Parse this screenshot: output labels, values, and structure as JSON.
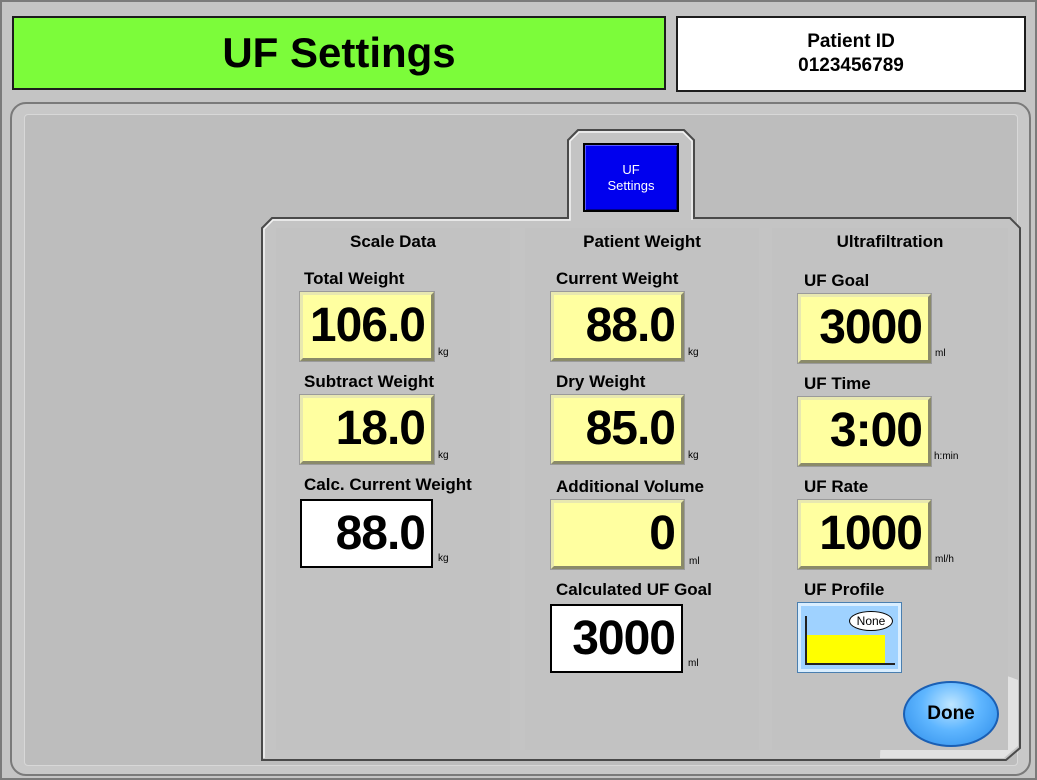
{
  "header": {
    "title": "UF Settings",
    "patient_id_label": "Patient ID",
    "patient_id_value": "0123456789"
  },
  "tab": {
    "line1": "UF",
    "line2": "Settings"
  },
  "scale_data": {
    "title": "Scale Data",
    "total_weight_label": "Total Weight",
    "total_weight_value": "106.0",
    "total_weight_unit": "kg",
    "subtract_weight_label": "Subtract Weight",
    "subtract_weight_value": "18.0",
    "subtract_weight_unit": "kg",
    "calc_current_weight_label": "Calc. Current Weight",
    "calc_current_weight_value": "88.0",
    "calc_current_weight_unit": "kg"
  },
  "patient_weight": {
    "title": "Patient Weight",
    "current_weight_label": "Current Weight",
    "current_weight_value": "88.0",
    "current_weight_unit": "kg",
    "dry_weight_label": "Dry Weight",
    "dry_weight_value": "85.0",
    "dry_weight_unit": "kg",
    "additional_volume_label": "Additional Volume",
    "additional_volume_value": "0",
    "additional_volume_unit": "ml",
    "calculated_uf_goal_label": "Calculated UF Goal",
    "calculated_uf_goal_value": "3000",
    "calculated_uf_goal_unit": "ml"
  },
  "ultrafiltration": {
    "title": "Ultrafiltration",
    "uf_goal_label": "UF Goal",
    "uf_goal_value": "3000",
    "uf_goal_unit": "ml",
    "uf_time_label": "UF Time",
    "uf_time_value": "3:00",
    "uf_time_unit": "h:min",
    "uf_rate_label": "UF Rate",
    "uf_rate_value": "1000",
    "uf_rate_unit": "ml/h",
    "uf_profile_label": "UF Profile",
    "uf_profile_value": "None"
  },
  "done_label": "Done",
  "colors": {
    "title_bar": "#7cfc3a",
    "value_field": "#ffffa0",
    "tab_button": "#0000ee",
    "done_button": "#5fb6ff",
    "profile_fill": "#ffff00"
  }
}
